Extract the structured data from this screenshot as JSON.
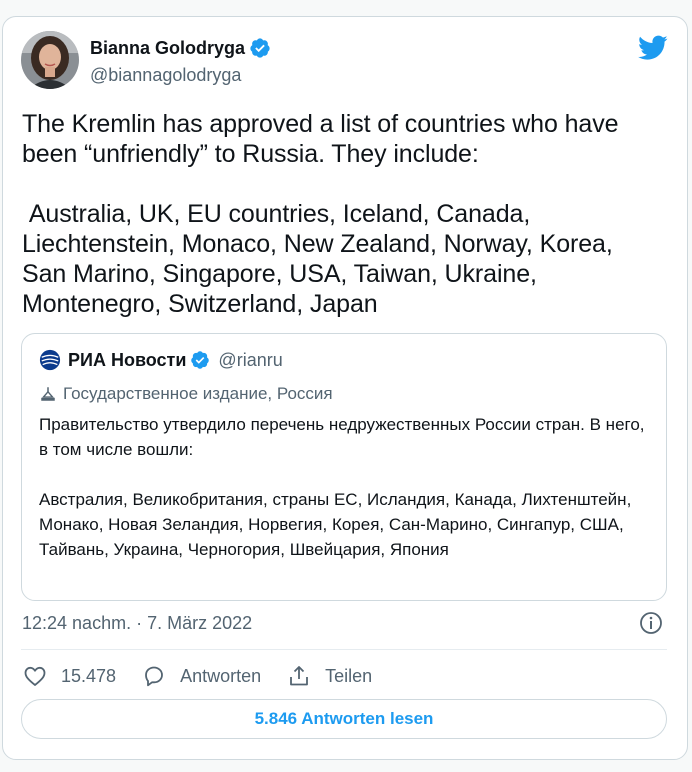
{
  "colors": {
    "accent": "#1d9bf0",
    "verified": "#1d9bf0",
    "secondary_text": "#536471",
    "border": "#cfd9de"
  },
  "author": {
    "name": "Bianna Golodryga",
    "handle": "@biannagolodryga",
    "avatar_icon": "avatar-photo",
    "verified_icon": "verified-badge-icon"
  },
  "platform_icon": "twitter-bird-icon",
  "tweet": {
    "text": "The Kremlin has approved a list of countries who have been “unfriendly” to Russia. They include:\n\n Australia, UK, EU countries, Iceland, Canada, Liechtenstein, Monaco, New Zealand, Norway, Korea, San Marino, Singapore, USA, Taiwan, Ukraine, Montenegro, Switzerland, Japan"
  },
  "quoted": {
    "name": "РИА Новости",
    "handle": "@rianru",
    "label": "Государственное издание, Россия",
    "text": "Правительство утвердило перечень недружественных России стран. В него, в том числе вошли:\n\nАвстралия, Великобритания, страны ЕС, Исландия, Канада, Лихтенштейн, Монако, Новая Зеландия, Норвегия, Корея, Сан-Марино, Сингапур, США, Тайвань, Украина, Черногория, Швейцария, Япония"
  },
  "meta": {
    "timestamp": "12:24 nachm. · 7. März 2022",
    "info_icon": "info-icon"
  },
  "actions": {
    "like_count": "15.478",
    "reply_label": "Antworten",
    "share_label": "Teilen"
  },
  "read_replies_label": "5.846 Antworten lesen"
}
